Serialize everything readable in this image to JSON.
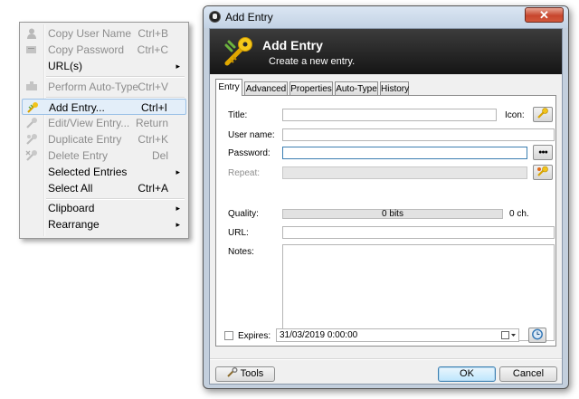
{
  "context_menu": {
    "items": [
      {
        "label": "Copy User Name",
        "shortcut": "Ctrl+B",
        "disabled": true,
        "icon": "user-icon"
      },
      {
        "label": "Copy Password",
        "shortcut": "Ctrl+C",
        "disabled": true,
        "icon": "key-icon"
      },
      {
        "label": "URL(s)",
        "shortcut": "",
        "disabled": false,
        "submenu": true
      },
      {
        "label": "Perform Auto-Type",
        "shortcut": "Ctrl+V",
        "disabled": true,
        "icon": "keyboard-icon"
      },
      {
        "label": "Add Entry...",
        "shortcut": "Ctrl+I",
        "disabled": false,
        "icon": "add-entry-icon",
        "highlighted": true
      },
      {
        "label": "Edit/View Entry...",
        "shortcut": "Return",
        "disabled": true,
        "icon": "edit-entry-icon"
      },
      {
        "label": "Duplicate Entry",
        "shortcut": "Ctrl+K",
        "disabled": true,
        "icon": "duplicate-entry-icon"
      },
      {
        "label": "Delete Entry",
        "shortcut": "Del",
        "disabled": true,
        "icon": "delete-entry-icon"
      },
      {
        "label": "Selected Entries",
        "shortcut": "",
        "disabled": false,
        "submenu": true
      },
      {
        "label": "Select All",
        "shortcut": "Ctrl+A",
        "disabled": false
      },
      {
        "label": "Clipboard",
        "shortcut": "",
        "disabled": false,
        "submenu": true
      },
      {
        "label": "Rearrange",
        "shortcut": "",
        "disabled": false,
        "submenu": true
      }
    ],
    "submenu_arrow": "▸"
  },
  "window": {
    "title": "Add Entry",
    "close_glyph": "✕",
    "banner": {
      "title": "Add Entry",
      "subtitle": "Create a new entry."
    },
    "tabs": [
      "Entry",
      "Advanced",
      "Properties",
      "Auto-Type",
      "History"
    ],
    "active_tab": "Entry",
    "form": {
      "title_label": "Title:",
      "icon_label": "Icon:",
      "username_label": "User name:",
      "password_label": "Password:",
      "password_toggle": "●●●",
      "repeat_label": "Repeat:",
      "quality_label": "Quality:",
      "quality_value": "0 bits",
      "quality_chars": "0 ch.",
      "url_label": "URL:",
      "notes_label": "Notes:",
      "expires_label": "Expires:",
      "expires_checked": false,
      "expires_value": "31/03/2019  0:00:00"
    },
    "buttons": {
      "tools": "Tools",
      "ok": "OK",
      "cancel": "Cancel"
    },
    "colors": {
      "banner": "#1e1e1e",
      "accent": "#3c7fb1",
      "close": "#c7462d"
    }
  }
}
